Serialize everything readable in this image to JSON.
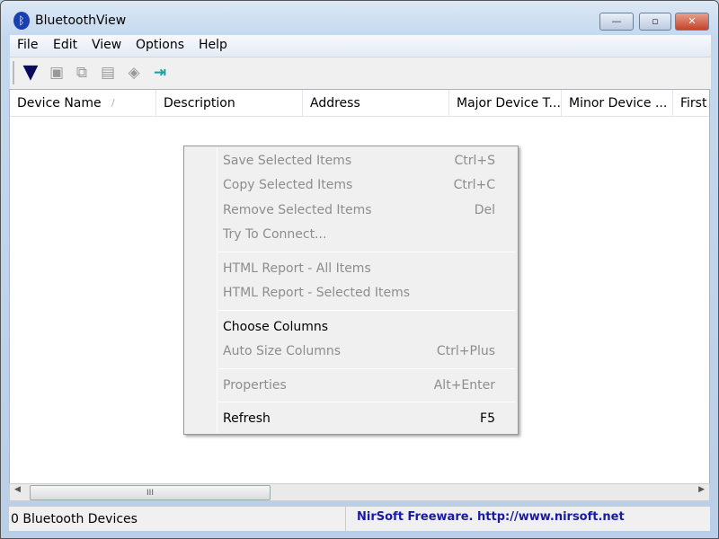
{
  "window": {
    "title": "BluetoothView",
    "icon": "bluetooth-icon",
    "minimize": "—",
    "maximize": "▫",
    "close": "✕"
  },
  "menu": [
    "File",
    "Edit",
    "View",
    "Options",
    "Help"
  ],
  "toolbar": [
    "filter-icon",
    "save-icon",
    "copy-icon",
    "properties-icon",
    "report-icon",
    "exit-icon"
  ],
  "columns": [
    "Device Name",
    "Description",
    "Address",
    "Major Device T...",
    "Minor Device ...",
    "First"
  ],
  "sort_indicator": "/",
  "context_menu": [
    {
      "label": "Save Selected Items",
      "shortcut": "Ctrl+S",
      "enabled": false
    },
    {
      "label": "Copy Selected Items",
      "shortcut": "Ctrl+C",
      "enabled": false
    },
    {
      "label": "Remove Selected Items",
      "shortcut": "Del",
      "enabled": false
    },
    {
      "label": "Try To Connect...",
      "shortcut": "",
      "enabled": false
    },
    {
      "label": "HTML Report - All Items",
      "shortcut": "",
      "enabled": false
    },
    {
      "label": "HTML Report - Selected Items",
      "shortcut": "",
      "enabled": false
    },
    {
      "label": "Choose Columns",
      "shortcut": "",
      "enabled": true
    },
    {
      "label": "Auto Size Columns",
      "shortcut": "Ctrl+Plus",
      "enabled": false
    },
    {
      "label": "Properties",
      "shortcut": "Alt+Enter",
      "enabled": false
    },
    {
      "label": "Refresh",
      "shortcut": "F5",
      "enabled": true
    }
  ],
  "scrollbar": {
    "thumb_grip": "III",
    "left": "◀",
    "right": "▶"
  },
  "status": {
    "count": "0 Bluetooth Devices",
    "link": "NirSoft Freeware.  http://www.nirsoft.net"
  },
  "colors": {
    "link": "#1a1aa8",
    "disabled": "#8d8d8d"
  }
}
